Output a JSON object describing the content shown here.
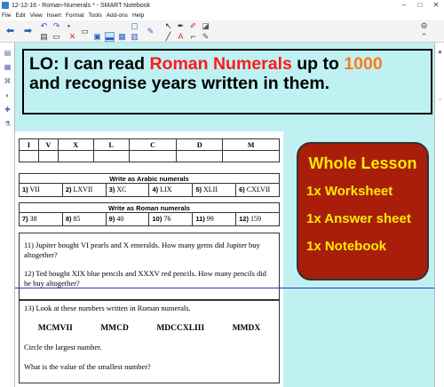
{
  "window": {
    "title": "12-12-16 - Roman-Numerals * - SMART Notebook",
    "minimize": "–",
    "maximize": "□",
    "close": "✕"
  },
  "menu": [
    "File",
    "Edit",
    "View",
    "Insert",
    "Format",
    "Tools",
    "Add-ons",
    "Help"
  ],
  "toolbar": {
    "icons": [
      "arrow-left-icon",
      "arrow-right-icon",
      "undo-icon",
      "redo-icon",
      "delete-icon",
      "screen-shade-icon",
      "display-icon",
      "table-icon",
      "properties-icon",
      "select-icon",
      "pen-icon",
      "creative-pen-icon",
      "eraser-icon",
      "line-icon",
      "shapes-icon",
      "text-icon",
      "fill-icon",
      "magic-pen-icon"
    ],
    "accent": "#1d5fbf"
  },
  "lesson_objective": {
    "prefix": "LO: I can read ",
    "highlight_red": "Roman Numerals",
    "middle": " up to ",
    "highlight_orange": "1000",
    "line2": "and recognise years written in them."
  },
  "key_table": {
    "numerals": [
      "I",
      "V",
      "X",
      "L",
      "C",
      "D",
      "M"
    ]
  },
  "arabic_section": {
    "heading": "Write as Arabic numerals",
    "items": [
      {
        "num": "1)",
        "val": "VII"
      },
      {
        "num": "2)",
        "val": "LXVII"
      },
      {
        "num": "3)",
        "val": "XC"
      },
      {
        "num": "4)",
        "val": "LIX"
      },
      {
        "num": "5)",
        "val": "XLII"
      },
      {
        "num": "6)",
        "val": "CXLVII"
      }
    ]
  },
  "roman_section": {
    "heading": "Write as Roman numerals",
    "items": [
      {
        "num": "7)",
        "val": "38"
      },
      {
        "num": "8)",
        "val": "85"
      },
      {
        "num": "9)",
        "val": "40"
      },
      {
        "num": "10)",
        "val": "76"
      },
      {
        "num": "11)",
        "val": "99"
      },
      {
        "num": "12)",
        "val": "159"
      }
    ]
  },
  "questions": {
    "q11": "11) Jupiter bought VI pearls and X emeralds. How many gems did Jupiter buy altogether?",
    "q12": "12) Ted bought XIX blue pencils and XXXV red pencils. How many pencils did he buy altogether?",
    "q13": "13)  Look at these numbers written in Roman numerals.",
    "q13_numerals": [
      "MCMVII",
      "MMCD",
      "MDCCXLIII",
      "MMDX"
    ],
    "q13_a": "Circle the largest number.",
    "q13_b": "What is the value of the smallest number?"
  },
  "lesson_box": {
    "title": "Whole Lesson",
    "items": [
      "1x Worksheet",
      "1x Answer sheet",
      "1x Notebook"
    ],
    "bg": "#a81e0a",
    "text_color": "#ffea00"
  },
  "canvas_bg": "#bff1f2"
}
